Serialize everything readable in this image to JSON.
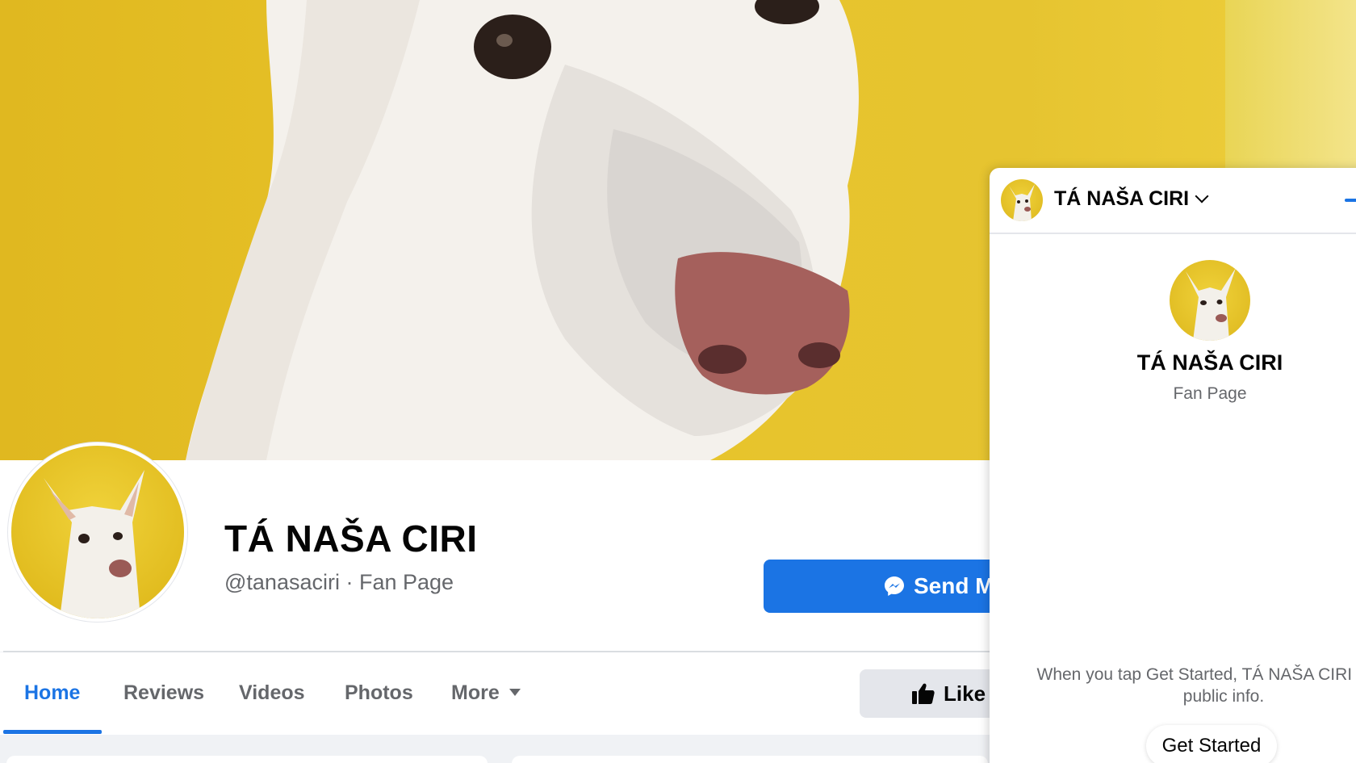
{
  "page": {
    "name": "TÁ NAŠA CIRI",
    "handle_line": "@tanasaciri · Fan Page",
    "send_button_label": "Send M",
    "like_button_label": "Like"
  },
  "tabs": [
    {
      "label": "Home",
      "active": true
    },
    {
      "label": "Reviews",
      "active": false
    },
    {
      "label": "Videos",
      "active": false
    },
    {
      "label": "Photos",
      "active": false
    },
    {
      "label": "More",
      "active": false
    }
  ],
  "chat": {
    "header_title": "TÁ NAŠA CIRI",
    "name": "TÁ NAŠA CIRI",
    "subtitle": "Fan Page",
    "info_text": "When you tap Get Started, TÁ NAŠA CIRI wi your public info.",
    "get_started_label": "Get Started"
  },
  "colors": {
    "accent": "#1b74e4",
    "cover_yellow": "#e6c430",
    "text_primary": "#050505",
    "text_secondary": "#65676b"
  },
  "icons": {
    "messenger": "messenger-icon",
    "thumbs_up": "thumbs-up-icon",
    "dropdown": "caret-down-icon",
    "chevron": "chevron-down-icon",
    "minimize": "minimize-icon"
  }
}
